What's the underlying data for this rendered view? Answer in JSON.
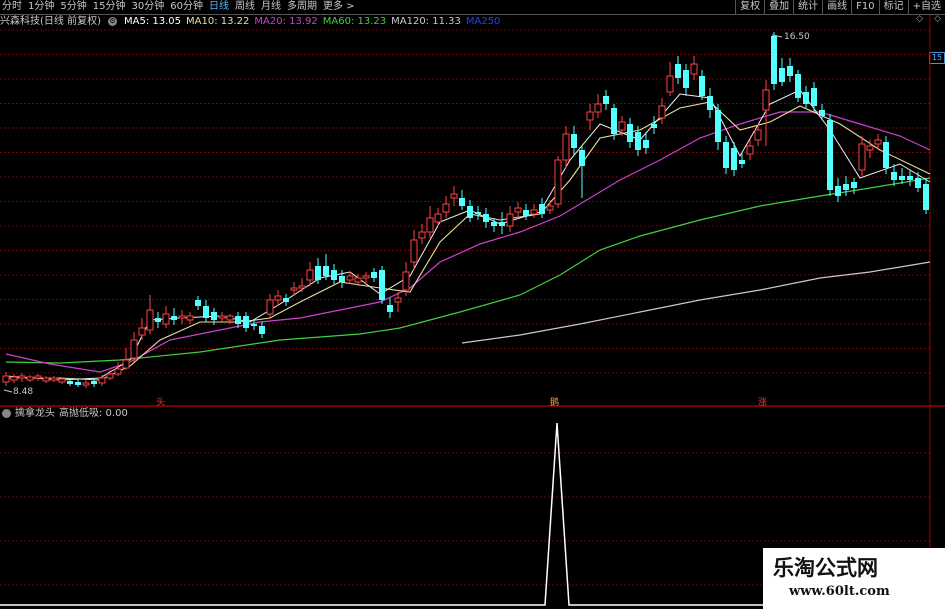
{
  "toolbar": {
    "periods": [
      "分时",
      "1分钟",
      "5分钟",
      "15分钟",
      "30分钟",
      "60分钟",
      "日线",
      "周线",
      "月线",
      "多周期",
      "更多 >"
    ],
    "active_period": "日线",
    "right_tools": [
      "复权",
      "叠加",
      "统计",
      "画线",
      "F10",
      "标记",
      "+自选"
    ]
  },
  "info": {
    "title": "兴森科技(日线 前复权)",
    "ma": [
      {
        "label": "MA5: 13.05",
        "color": "#ffffff"
      },
      {
        "label": "MA10: 13.22",
        "color": "#e8e0a0"
      },
      {
        "label": "MA20: 13.92",
        "color": "#d040d0"
      },
      {
        "label": "MA60: 13.23",
        "color": "#40d040"
      },
      {
        "label": "MA120: 11.33",
        "color": "#c8c8c8"
      },
      {
        "label": "MA250",
        "color": "#2040ff"
      }
    ]
  },
  "price_tag": "15",
  "high_label": "16.50",
  "low_label": "8.48",
  "signals": [
    {
      "label": "头",
      "color": "#ff3030"
    },
    {
      "label": "鹅",
      "color": "#ffa040"
    },
    {
      "label": "涨",
      "color": "#ff3030"
    }
  ],
  "indicator": {
    "name": "擒拿龙头",
    "value_label": "高抛低吸: 0.00"
  },
  "watermark": {
    "line1": "乐淘公式网",
    "line2": "www.60lt.com"
  },
  "colors": {
    "up": "#ff4040",
    "down": "#54ffff",
    "grid": "#7a0000",
    "indicator_line": "#ffffff"
  }
}
